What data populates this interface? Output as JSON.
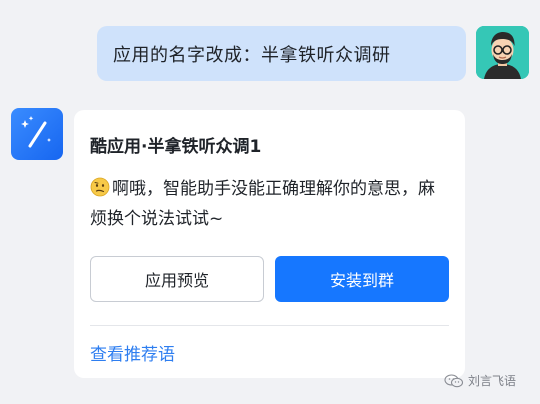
{
  "user_message": {
    "text": "应用的名字改成：半拿铁听众调研"
  },
  "bot_card": {
    "title": "酷应用·半拿铁听众调1",
    "message": "啊哦，智能助手没能正确理解你的意思，麻烦换个说法试试~",
    "emoji_icon": "confused-face-icon",
    "buttons": {
      "preview_label": "应用预览",
      "install_label": "安装到群"
    },
    "link_label": "查看推荐语"
  },
  "watermark": {
    "text": "刘言飞语"
  },
  "colors": {
    "primary": "#1677ff",
    "user_bubble": "#cfe2fb",
    "link": "#2e7ef0",
    "background": "#f1f2f5"
  }
}
